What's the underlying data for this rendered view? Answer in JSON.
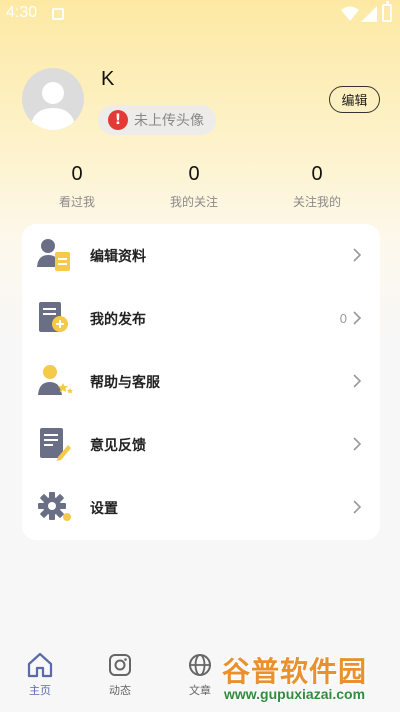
{
  "status_bar": {
    "time": "4:30"
  },
  "profile": {
    "username": "K",
    "avatar_notice": "未上传头像",
    "edit_label": "编辑"
  },
  "stats": [
    {
      "value": "0",
      "label": "看过我"
    },
    {
      "value": "0",
      "label": "我的关注"
    },
    {
      "value": "0",
      "label": "关注我的"
    }
  ],
  "menu": {
    "items": [
      {
        "label": "编辑资料",
        "icon": "edit-profile-icon"
      },
      {
        "label": "我的发布",
        "count": "0",
        "icon": "my-posts-icon"
      },
      {
        "label": "帮助与客服",
        "icon": "customer-service-icon"
      },
      {
        "label": "意见反馈",
        "icon": "feedback-icon"
      },
      {
        "label": "设置",
        "icon": "settings-icon"
      }
    ]
  },
  "bottom_nav": {
    "items": [
      {
        "label": "主页",
        "icon": "home-icon",
        "active": true
      },
      {
        "label": "动态",
        "icon": "camera-icon"
      },
      {
        "label": "文章",
        "icon": "globe-icon"
      }
    ]
  },
  "watermark": {
    "title": "谷普软件园",
    "url": "www.gupuxiazai.com"
  },
  "colors": {
    "accent": "#5a6aa8",
    "icon_gray": "#6b6f85",
    "icon_yellow": "#f5c94a",
    "warning": "#e53935"
  }
}
